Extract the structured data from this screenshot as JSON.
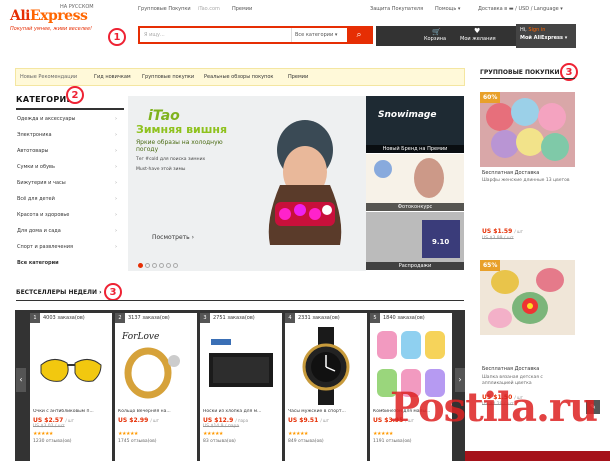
{
  "header": {
    "logo_ali": "Ali",
    "logo_express": "Express",
    "region": "НА РУССКОМ",
    "slogan": "Покупай умнее, живи веселее!",
    "top_links": [
      "Групповые Покупки",
      "iTao.com",
      "Премии"
    ],
    "buyer_protection": "Защита Покупателя",
    "help": "Помощь",
    "delivery": "Доставка в",
    "currency": "USD",
    "language": "Language",
    "search_placeholder": "Я ищу...",
    "category_select": "Все категории",
    "cart": "Корзина",
    "wishlist": "Мои желания",
    "greeting": "Hi,",
    "signin": "Sign in",
    "my_ali": "Мой AliExpress"
  },
  "annotations": {
    "one": "1",
    "two": "2",
    "three": "3"
  },
  "nav": {
    "items": [
      "Новые Рекомендации",
      "Гид новичкам",
      "Групповые покупки",
      "Реальные обзоры покупок",
      "Премии"
    ]
  },
  "categories": {
    "title": "КАТЕГОРИИ",
    "items": [
      "Одежда и аксессуары",
      "Электроника",
      "Автотовары",
      "Сумки и обувь",
      "Бижутерия и часы",
      "Всё для детей",
      "Красота и здоровье",
      "Для дома и сада",
      "Спорт и развлечения"
    ],
    "all": "Все категории"
  },
  "banner": {
    "brand": "iTao",
    "headline": "Зимняя вишня",
    "subtitle": "Яркие образы на холодную погоду",
    "bullet1": "Тег #cold для поиска зимних",
    "bullet2": "Must-have этой зимы",
    "button": "Посмотреть ›"
  },
  "side_tiles": [
    {
      "title": "Snowimage",
      "caption": "Новый Бренд на Премии"
    },
    {
      "title": "",
      "caption": "Фотоконкурс"
    },
    {
      "title": "9.10",
      "caption": "Распродажи"
    }
  ],
  "group_buy": {
    "title": "ГРУППОВЫЕ ПОКУПКИ",
    "items": [
      {
        "pct": "60%",
        "label": "Бесплатная Доставка",
        "desc": "Шарфы женские длинные 13 цветов",
        "price": "US $1.59",
        "unit": "/ шт",
        "old": "US $3.99 / шт"
      },
      {
        "pct": "65%",
        "label": "Бесплатная Доставка",
        "desc": "Шапка вязаная детская с аппликацией цветка",
        "price": "US $1.50",
        "unit": "/ шт",
        "old": "US $4.29 / шт"
      }
    ]
  },
  "bestsellers": {
    "title": "БЕСТСЕЛЛЕРЫ НЕДЕЛИ",
    "items": [
      {
        "num": "1",
        "orders": "4003 заказа(ов)",
        "name": "Очки с антибликовым п...",
        "price": "US $2.57",
        "unit": "/ шт",
        "old": "US $3.02 / шт",
        "reviews": "1230 отзыва(ов)"
      },
      {
        "num": "2",
        "orders": "3137 заказа(ов)",
        "name": "Кольцо Вечерняя на...",
        "price": "US $2.99",
        "unit": "/ шт",
        "old": "",
        "reviews": "1745 отзыва(ов)"
      },
      {
        "num": "3",
        "orders": "2751 заказа(ов)",
        "name": "Носки из хлопка для м...",
        "price": "US $12.9",
        "unit": "/ пара",
        "old": "US $14.9 / пара",
        "reviews": "83 отзыва(ов)"
      },
      {
        "num": "4",
        "orders": "2331 заказа(ов)",
        "name": "Часы мужские в спорт...",
        "price": "US $9.51",
        "unit": "/ шт",
        "old": "",
        "reviews": "849 отзыва(ов)"
      },
      {
        "num": "5",
        "orders": "1840 заказа(ов)",
        "name": "Комбинезон для малы...",
        "price": "US $3.95",
        "unit": "/ шт",
        "old": "",
        "reviews": "1191 отзыва(ов)"
      }
    ]
  },
  "watermark": "Postila.ru",
  "colors": {
    "brand": "#e62e04",
    "dark": "#333333",
    "price": "#e62e04",
    "nav_bg": "#fff9d9"
  }
}
